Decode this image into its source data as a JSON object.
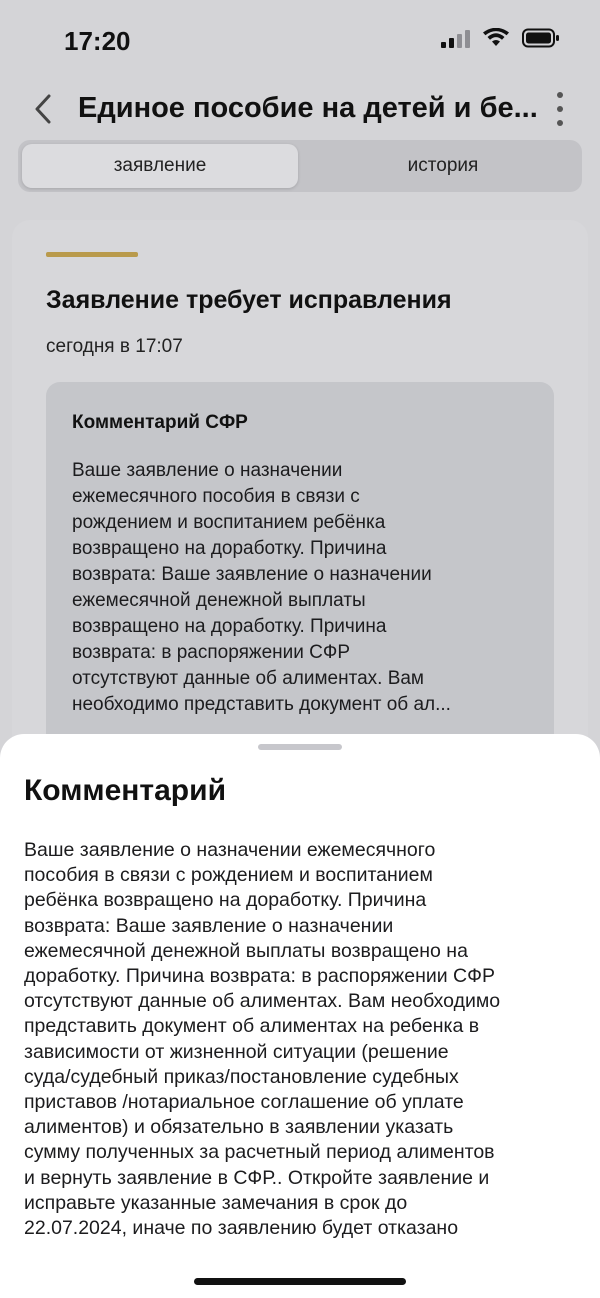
{
  "status_bar": {
    "time": "17:20",
    "icons": [
      "signal-icon",
      "wifi-icon",
      "battery-icon"
    ]
  },
  "nav": {
    "title": "Единое пособие на детей и бе...",
    "back_icon": "chevron-left-icon",
    "more_icon": "more-vertical-icon"
  },
  "tabs": [
    {
      "label": "заявление",
      "active": true
    },
    {
      "label": "история",
      "active": false
    }
  ],
  "card": {
    "title": "Заявление требует исправления",
    "date": "сегодня в 17:07",
    "accent_color": "#b99a4b",
    "comment": {
      "title": "Комментарий СФР",
      "lines": [
        "Ваше заявление о назначении",
        "ежемесячного пособия в связи с",
        "рождением и воспитанием ребёнка",
        "возвращено на доработку. Причина",
        "возврата: Ваше заявление о назначении",
        "ежемесячной денежной выплаты",
        "возвращено на доработку. Причина",
        "возврата: в распоряжении СФР",
        "отсутствуют данные об алиментах. Вам",
        "необходимо представить документ об ал..."
      ]
    }
  },
  "sheet": {
    "title": "Комментарий",
    "lines": [
      "Ваше заявление о назначении ежемесячного",
      "пособия в связи с рождением и воспитанием",
      "ребёнка возвращено на доработку. Причина",
      "возврата: Ваше заявление о назначении",
      "ежемесячной денежной выплаты возвращено на",
      "доработку. Причина возврата: в распоряжении СФР",
      "отсутствуют данные об алиментах. Вам необходимо",
      "представить документ об алиментах на ребенка в",
      "зависимости от жизненной ситуации (решение",
      "суда/судебный приказ/постановление судебных",
      "приставов /нотариальное соглашение об уплате",
      "алиментов) и обязательно в заявлении указать",
      "сумму полученных за расчетный период алиментов",
      "и вернуть заявление в СФР.. Откройте заявление и",
      "исправьте указанные замечания в срок до",
      "22.07.2024, иначе по заявлению будет отказано"
    ]
  }
}
